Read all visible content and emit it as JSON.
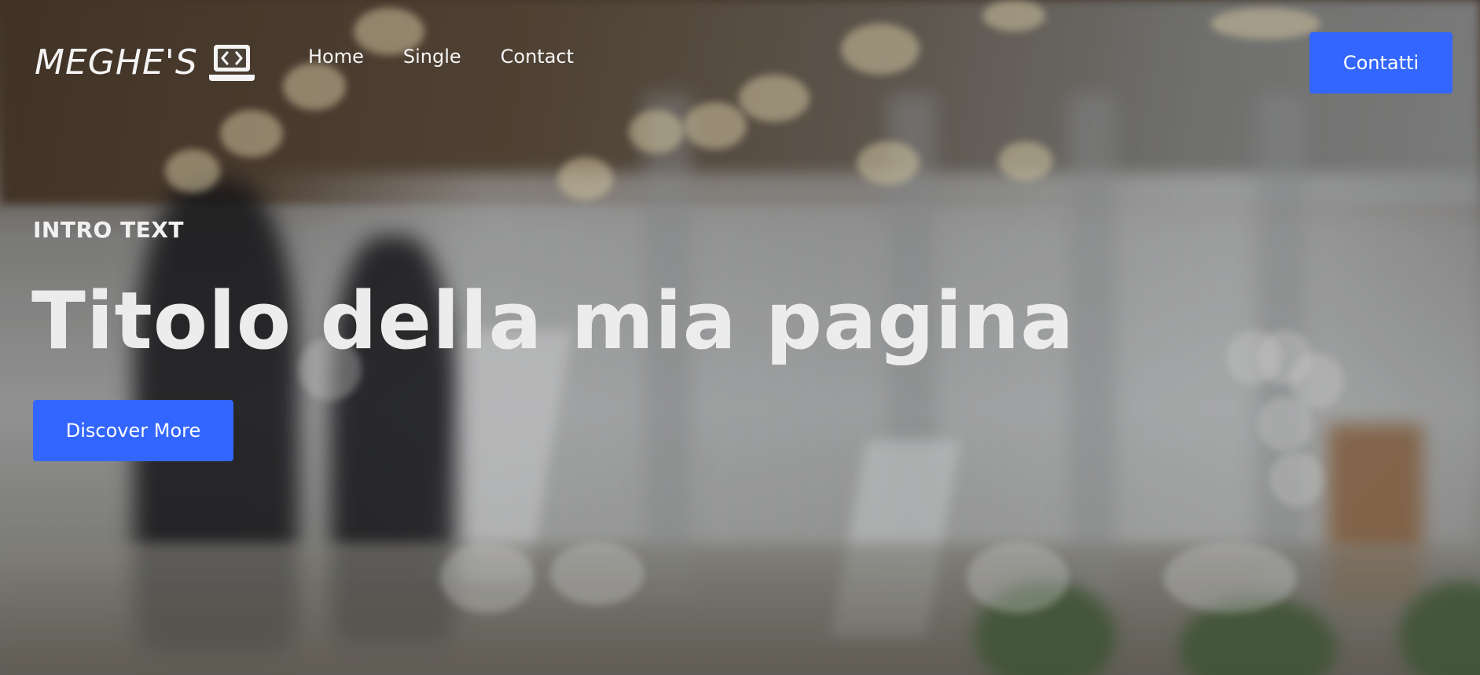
{
  "header": {
    "logo_text": "MEGHE'S",
    "logo_icon": "laptop-code-icon",
    "nav": [
      {
        "label": "Home"
      },
      {
        "label": "Single"
      },
      {
        "label": "Contact"
      }
    ],
    "cta_label": "Contatti"
  },
  "hero": {
    "intro": "INTRO TEXT",
    "title": "Titolo della mia pagina",
    "button_label": "Discover More"
  },
  "colors": {
    "accent": "#3366ff",
    "text": "#f1f1f1"
  }
}
